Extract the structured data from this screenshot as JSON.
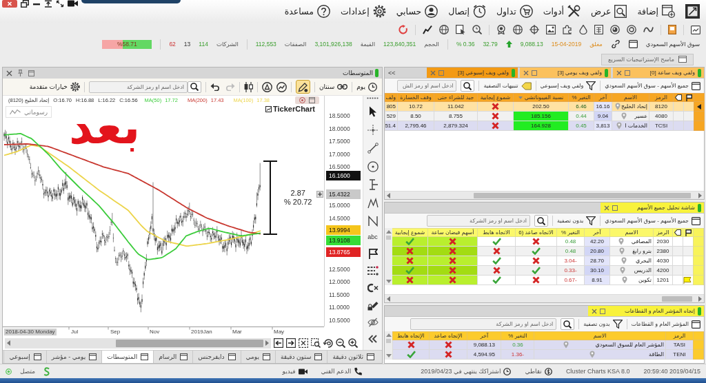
{
  "menu_bar": {
    "items": [
      "إضافة",
      "عرض",
      "أدوات",
      "تداول",
      "إتصال",
      "حسابي",
      "إعدادات",
      "مساعدة"
    ]
  },
  "market_bar": {
    "market": "سوق الأسهم السعودي",
    "state": "مغلق",
    "date": "15-04-2019",
    "index": "9,088.13",
    "rising": true,
    "change": "32.79",
    "change_pct": "% 0.36",
    "volume_label": "الحجم",
    "volume": "123,840,351",
    "value_label": "القيمة",
    "value": "3,101,926,138",
    "trades_label": "الصفقات",
    "trades": "112,553",
    "companies_label": "الشركات",
    "advancing": "114",
    "unchanged": "13",
    "declining": "62",
    "breadth": {
      "label": "%58.71",
      "level": 0.5871
    }
  },
  "strategy_button": {
    "label": "ماسح الإستراتيجيات السريع"
  },
  "chart_panel": {
    "title": "المتوسطات",
    "toolbar": {
      "period": "يوم",
      "range": "سنتان",
      "pen_active": true,
      "search_placeholder": "ادخل اسم او رمز الشركة",
      "advanced": "خيارات متقدمة"
    },
    "info": {
      "indicators": [
        {
          "name": "MA(100)",
          "value": "17.38",
          "color": "#ecd44a"
        },
        {
          "name": "MA(200)",
          "value": "17.43",
          "color": "#c8372f"
        },
        {
          "name": "MA(50)",
          "value": "17.72",
          "color": "#3ccc3c"
        }
      ],
      "ohlc": [
        "C:16.56",
        "L:16.22",
        "H:16.88",
        "O:16.70"
      ],
      "symbol": "(8120) إتحاد الخليج"
    },
    "drawings_button": "رسوماتي",
    "logo": "TickerChart",
    "annotation": "بعد",
    "measure": {
      "change": "2.87",
      "percent": "% 20.72"
    },
    "y_ticks": [
      "18.5000",
      "18.0000",
      "17.5000",
      "17.0000",
      "16.5000",
      "15.0000",
      "14.5000",
      "12.5000",
      "12.0000",
      "11.5000",
      "11.0000",
      "10.5000"
    ],
    "price_tags": [
      {
        "label": "16.1600",
        "color": "#111111"
      },
      {
        "label": "15.4322",
        "color": "#c9c9c9"
      },
      {
        "label": "13.9994",
        "color": "#f5c51c"
      },
      {
        "label": "13.9108",
        "color": "#36dd36"
      },
      {
        "label": "13.8765",
        "color": "#e02424"
      }
    ],
    "x_labels": [
      "May",
      "Mar",
      "2019Jan",
      "Nov",
      "Sep",
      "Jul",
      "2018-04-30 Monday"
    ],
    "text_tool": "abc",
    "tabs": [
      {
        "label": "ثلاثون دقيقة",
        "selected": false
      },
      {
        "label": "ستون دقيقة",
        "selected": false
      },
      {
        "label": "يومي",
        "selected": false
      },
      {
        "label": "دايفرجنس",
        "selected": false
      },
      {
        "label": "الرسام",
        "selected": false
      },
      {
        "label": "المتوسطات",
        "selected": true
      },
      {
        "label": "يومي - مؤشر",
        "selected": false
      },
      {
        "label": "إسبوعي",
        "selected": false
      }
    ]
  },
  "watchlist": {
    "collapse_label": "<<",
    "tabs": [
      {
        "label": "ولفي ويف ساعة [0]",
        "selected": false
      },
      {
        "label": "ولفي ويف يومي [3]",
        "selected": false
      },
      {
        "label": "ولفي ويف إسبوعي [3]",
        "selected": true
      }
    ],
    "toolbar": {
      "scope": "جميع الأسهم - سوق الأسهم السعودي",
      "filter": "ولفي ويف إسبوعي",
      "alerts": "تنبيهات التصفية",
      "search_placeholder": "ادخل اسم او رمز الش"
    },
    "columns": [
      {
        "label": "الرمز",
        "sorted": false
      },
      {
        "label": "الاسم",
        "sorted": false
      },
      {
        "label": "آخر",
        "sorted": false
      },
      {
        "label": "التغير %",
        "sorted": false
      },
      {
        "label": "نسبة الفيبوناتشي",
        "sorted": true
      },
      {
        "label": "شموع إيجابية",
        "sorted": false
      },
      {
        "label": "جيد للشراء حتى",
        "sorted": false
      },
      {
        "label": "وقف الخسارة",
        "sorted": false
      },
      {
        "label": "ولف",
        "sorted": false
      }
    ],
    "rows": [
      {
        "selected": true,
        "symbol": "8120",
        "name": "إتحاد الخليج",
        "last": "16.16",
        "change": "6.46",
        "falling": false,
        "fib": "202.50",
        "fib_highlight": false,
        "positive_candles": false,
        "buy_until": "11.042",
        "stop_loss": "10.72",
        "column_9": "805"
      },
      {
        "selected": false,
        "symbol": "4080",
        "name": "عسير",
        "last": "9.04",
        "change": "0.44",
        "falling": false,
        "fib": "185.156",
        "fib_highlight": true,
        "positive_candles": false,
        "buy_until": "8.755",
        "stop_loss": "8.50",
        "column_9": "529"
      },
      {
        "selected": false,
        "symbol": "TCSI",
        "name": "الخدمات ا",
        "last": "3,813",
        "change": "0.45",
        "falling": false,
        "fib": "164.928",
        "fib_highlight": true,
        "positive_candles": false,
        "buy_until": "2,879.324",
        "stop_loss": "2,795.46",
        "column_9": "51.4"
      }
    ]
  },
  "analysis": {
    "tab": "شاشة تحليل جميع الأسهم",
    "toolbar": {
      "scope": "جميع الأسهم - سوق الأسهم السعودي",
      "filter": "بدون تصفية",
      "search_placeholder": "ادخل اسم او رمز الشركة"
    },
    "columns": [
      "الرمز",
      "الاسم",
      "آخر",
      "التغير %",
      "الاتجاه صاعد (6",
      "الاتجاه هابط",
      "أسهم فيضان ساعة",
      "شموع إيجابية"
    ],
    "rows": [
      {
        "flagged": false,
        "symbol": "2030",
        "name": "المصافي",
        "last": "42.20",
        "change": "0.48",
        "falling": false,
        "up_trend": false,
        "down_trend": true,
        "flood": false,
        "positive_candles": true
      },
      {
        "flagged": false,
        "symbol": "2380",
        "name": "بترو رابغ",
        "last": "20.80",
        "change": "0.48",
        "falling": false,
        "up_trend": true,
        "down_trend": false,
        "flood": false,
        "positive_candles": false
      },
      {
        "flagged": false,
        "symbol": "4030",
        "name": "البحري",
        "last": "28.70",
        "change": "3.04-",
        "falling": true,
        "up_trend": false,
        "down_trend": true,
        "flood": false,
        "positive_candles": false
      },
      {
        "flagged": false,
        "symbol": "4200",
        "name": "الدريس",
        "last": "30.10",
        "change": "0.33-",
        "falling": true,
        "up_trend": true,
        "down_trend": false,
        "flood": false,
        "positive_candles": true
      },
      {
        "flagged": true,
        "symbol": "1201",
        "name": "تكوين",
        "last": "8.91",
        "change": "0.67-",
        "falling": true,
        "up_trend": false,
        "down_trend": true,
        "flood": false,
        "positive_candles": false
      }
    ]
  },
  "index_trends": {
    "tab": "إتجاه المؤشر العام و القطاعات",
    "toolbar": {
      "scope": "المؤشر العام و القطاعات",
      "filter": "بدون تصفية",
      "search_placeholder": "ادخل اسم او رمز الشركة"
    },
    "columns": [
      "الرمز",
      "الاسم",
      "التغير %",
      "آخر",
      "الإتجاه صاعد",
      "الإتجاه هابط"
    ],
    "rows": [
      {
        "symbol": "TASI",
        "name": "المؤشر العام للسوق السعودي",
        "change": "0.36",
        "falling": false,
        "last": "9,088.13",
        "up_trend": false,
        "down_trend": false
      },
      {
        "symbol": "TENI",
        "name": "الطاقة",
        "change": "1.36-",
        "falling": true,
        "last": "4,594.95",
        "up_trend": false,
        "down_trend": true
      }
    ]
  },
  "status_bar": {
    "clock": "20:59:40 2019/04/15",
    "version": "Cluster Charts KSA 8.0",
    "points": "نقاطي",
    "subscription": "اشتراكك ينتهي في 2019/04/23",
    "support": "الدعم الفني",
    "video": "فيديو",
    "connection": "متصل",
    "connected": true
  }
}
